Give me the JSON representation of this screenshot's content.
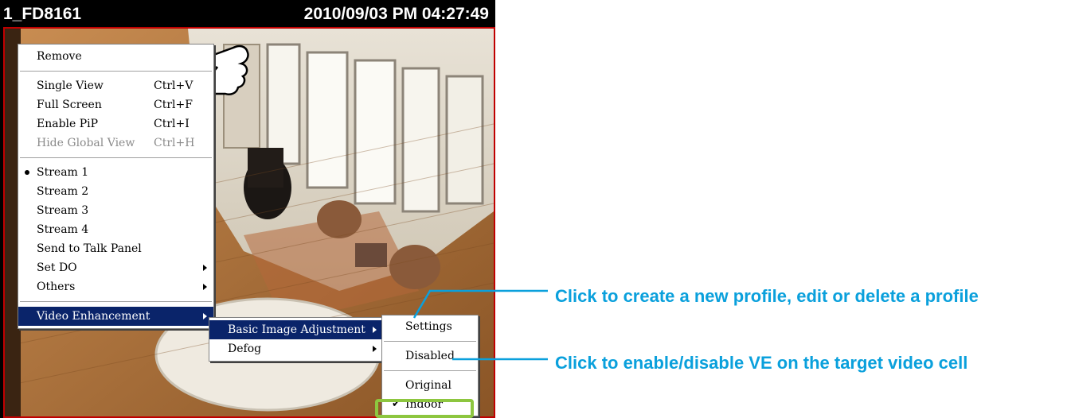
{
  "camera": {
    "name": "1_FD8161",
    "datetime": "2010/09/03 PM 04:27:49"
  },
  "context_menu": {
    "items": [
      {
        "label": "Remove",
        "shortcut": ""
      },
      {
        "label": "Single View",
        "shortcut": "Ctrl+V"
      },
      {
        "label": "Full Screen",
        "shortcut": "Ctrl+F"
      },
      {
        "label": "Enable PiP",
        "shortcut": "Ctrl+I"
      },
      {
        "label": "Hide Global View",
        "shortcut": "Ctrl+H",
        "disabled": true
      },
      {
        "label": "Stream 1",
        "selected_stream": true
      },
      {
        "label": "Stream 2"
      },
      {
        "label": "Stream 3"
      },
      {
        "label": "Stream 4"
      },
      {
        "label": "Send to Talk Panel"
      },
      {
        "label": "Set DO",
        "submenu": true
      },
      {
        "label": "Others",
        "submenu": true
      },
      {
        "label": "Video Enhancement",
        "submenu": true,
        "highlighted": true
      }
    ]
  },
  "video_enhancement_menu": {
    "items": [
      {
        "label": "Basic Image Adjustment",
        "highlighted": true
      },
      {
        "label": "Defog"
      }
    ]
  },
  "basic_image_menu": {
    "items": [
      {
        "label": "Settings"
      },
      {
        "label": "Disabled"
      },
      {
        "label": "Original"
      },
      {
        "label": "Indoor",
        "checked": true
      }
    ]
  },
  "callouts": {
    "settings": "Click to create a new profile, edit or delete a profile",
    "disabled": "Click to enable/disable VE on the target video cell"
  },
  "colors": {
    "callout": "#0aa0dc",
    "menu_highlight": "#0a246a",
    "indoor_highlight": "#8dc63f",
    "cell_border": "#c00000"
  }
}
